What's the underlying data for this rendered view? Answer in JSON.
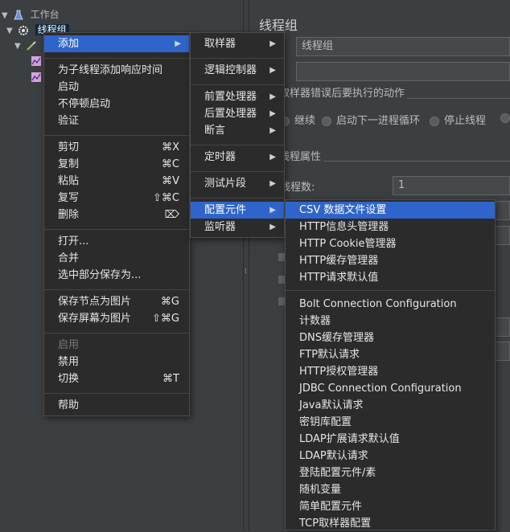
{
  "tree": {
    "root_label": "工作台",
    "thread_group_label": "线程组",
    "sampler_label": "",
    "listener1_label": "",
    "listener2_label": ""
  },
  "right_panel": {
    "title": "线程组",
    "name_value": "线程组",
    "comment_value": "",
    "error_action_label": "取样器错误后要执行的动作",
    "radio_continue": "继续",
    "radio_next_loop": "启动下一进程循环",
    "radio_stop_thread": "停止线程",
    "props_label": "线程属性",
    "threads_label": "线程数:",
    "threads_value": "1"
  },
  "context_menu": {
    "items": [
      {
        "label": "添加",
        "shortcut": "",
        "submenu": true
      },
      {
        "label": "为子线程添加响应时间",
        "shortcut": ""
      },
      {
        "label": "启动",
        "shortcut": ""
      },
      {
        "label": "不停顿启动",
        "shortcut": ""
      },
      {
        "label": "验证",
        "shortcut": ""
      },
      {
        "label": "剪切",
        "shortcut": "⌘X"
      },
      {
        "label": "复制",
        "shortcut": "⌘C"
      },
      {
        "label": "粘贴",
        "shortcut": "⌘V"
      },
      {
        "label": "复写",
        "shortcut": "⇧⌘C"
      },
      {
        "label": "删除",
        "shortcut": "⌦"
      },
      {
        "label": "打开...",
        "shortcut": ""
      },
      {
        "label": "合并",
        "shortcut": ""
      },
      {
        "label": "选中部分保存为...",
        "shortcut": ""
      },
      {
        "label": "保存节点为图片",
        "shortcut": "⌘G"
      },
      {
        "label": "保存屏幕为图片",
        "shortcut": "⇧⌘G"
      },
      {
        "label": "启用",
        "shortcut": "",
        "disabled": true
      },
      {
        "label": "禁用",
        "shortcut": ""
      },
      {
        "label": "切换",
        "shortcut": "⌘T"
      },
      {
        "label": "帮助",
        "shortcut": ""
      }
    ]
  },
  "add_submenu": {
    "items": [
      {
        "label": "取样器"
      },
      {
        "label": "逻辑控制器"
      },
      {
        "label": "前置处理器"
      },
      {
        "label": "后置处理器"
      },
      {
        "label": "断言"
      },
      {
        "label": "定时器"
      },
      {
        "label": "测试片段"
      },
      {
        "label": "配置元件"
      },
      {
        "label": "监听器"
      }
    ]
  },
  "config_submenu": {
    "items": [
      {
        "label": "CSV 数据文件设置"
      },
      {
        "label": "HTTP信息头管理器"
      },
      {
        "label": "HTTP Cookie管理器"
      },
      {
        "label": "HTTP缓存管理器"
      },
      {
        "label": "HTTP请求默认值"
      },
      {
        "label": "Bolt Connection Configuration"
      },
      {
        "label": "计数器"
      },
      {
        "label": "DNS缓存管理器"
      },
      {
        "label": "FTP默认请求"
      },
      {
        "label": "HTTP授权管理器"
      },
      {
        "label": "JDBC Connection Configuration"
      },
      {
        "label": "Java默认请求"
      },
      {
        "label": "密钥库配置"
      },
      {
        "label": "LDAP扩展请求默认值"
      },
      {
        "label": "LDAP默认请求"
      },
      {
        "label": "登陆配置元件/素"
      },
      {
        "label": "随机变量"
      },
      {
        "label": "简单配置元件"
      },
      {
        "label": "TCP取样器配置"
      }
    ]
  },
  "colors": {
    "highlight": "#2f65ca",
    "menu_bg": "#2b2b2b",
    "panel_bg": "#3c3f41"
  }
}
